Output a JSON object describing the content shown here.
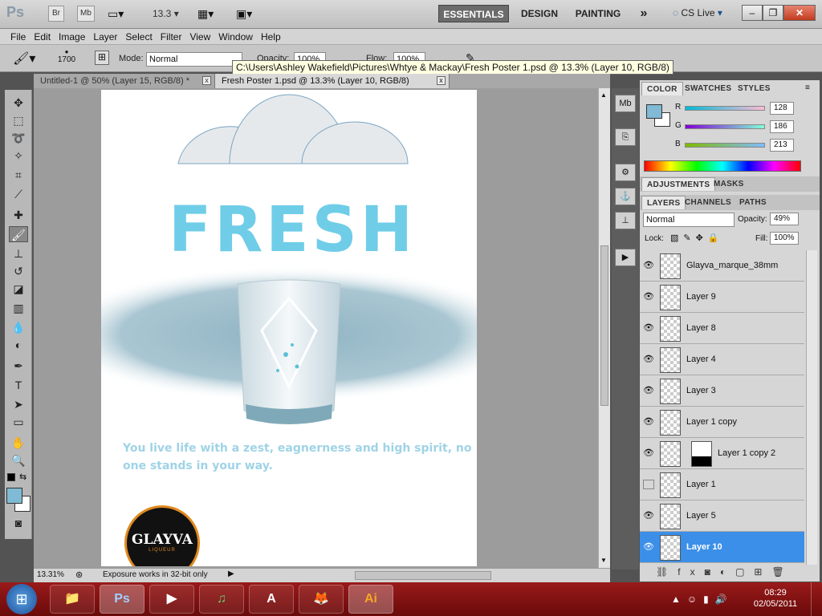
{
  "appbar": {
    "logo": "Ps",
    "bridge_label": "Br",
    "minibridge_label": "Mb",
    "zoom_value": "13.3",
    "workspaces": [
      "ESSENTIALS",
      "DESIGN",
      "PAINTING"
    ],
    "more_label": "»",
    "cslive_label": "CS Live",
    "win_min": "–",
    "win_max": "❐",
    "win_close": "✕"
  },
  "menubar": [
    "File",
    "Edit",
    "Image",
    "Layer",
    "Select",
    "Filter",
    "View",
    "Window",
    "Help"
  ],
  "options": {
    "brush_size": "1700",
    "mode_label": "Mode:",
    "mode_value": "Normal",
    "opacity_label": "Opacity:",
    "opacity_value": "100%",
    "flow_label": "Flow:",
    "flow_value": "100%",
    "tooltip": "C:\\Users\\Ashley Wakefield\\Pictures\\Whtye & Mackay\\Fresh Poster 1.psd @ 13.3% (Layer 10, RGB/8)"
  },
  "tabs": [
    {
      "label": "Untitled-1 @ 50% (Layer 15, RGB/8) *",
      "close": "x"
    },
    {
      "label": "Fresh Poster 1.psd @ 13.3% (Layer 10, RGB/8)",
      "close": "x"
    }
  ],
  "poster": {
    "headline": "FRESH",
    "tagline_line1": "You live life with a zest, eagnerness and high spirit, no",
    "tagline_line2": "one stands in your way.",
    "logo_text": "GLAYVA",
    "logo_subtext": "LIQUEUR"
  },
  "status": {
    "zoom": "13.31%",
    "info": "Exposure works in 32-bit only"
  },
  "color_panel": {
    "tabs": [
      "COLOR",
      "SWATCHES",
      "STYLES"
    ],
    "r_label": "R",
    "r_value": "128",
    "g_label": "G",
    "g_value": "186",
    "b_label": "B",
    "b_value": "213",
    "fg_color": "#80bad5"
  },
  "adjust_panel": {
    "tabs": [
      "ADJUSTMENTS",
      "MASKS"
    ]
  },
  "layers_panel": {
    "tabs": [
      "LAYERS",
      "CHANNELS",
      "PATHS"
    ],
    "blend_mode": "Normal",
    "opacity_label": "Opacity:",
    "opacity_value": "49%",
    "lock_label": "Lock:",
    "fill_label": "Fill:",
    "fill_value": "100%",
    "layers": [
      {
        "name": "Glayva_marque_38mm",
        "visible": true
      },
      {
        "name": "Layer 9",
        "visible": true
      },
      {
        "name": "Layer 8",
        "visible": true
      },
      {
        "name": "Layer 4",
        "visible": true
      },
      {
        "name": "Layer 3",
        "visible": true
      },
      {
        "name": "Layer 1 copy",
        "visible": true
      },
      {
        "name": "Layer 1 copy 2",
        "visible": true
      },
      {
        "name": "Layer 1",
        "visible": false
      },
      {
        "name": "Layer 5",
        "visible": true
      },
      {
        "name": "Layer 10",
        "visible": true
      }
    ]
  },
  "taskbar": {
    "start": "⊞",
    "apps": [
      "📁",
      "Ps",
      "▶",
      "♫",
      "A",
      "🦊",
      "Ai"
    ],
    "time": "08:29",
    "date": "02/05/2011"
  }
}
